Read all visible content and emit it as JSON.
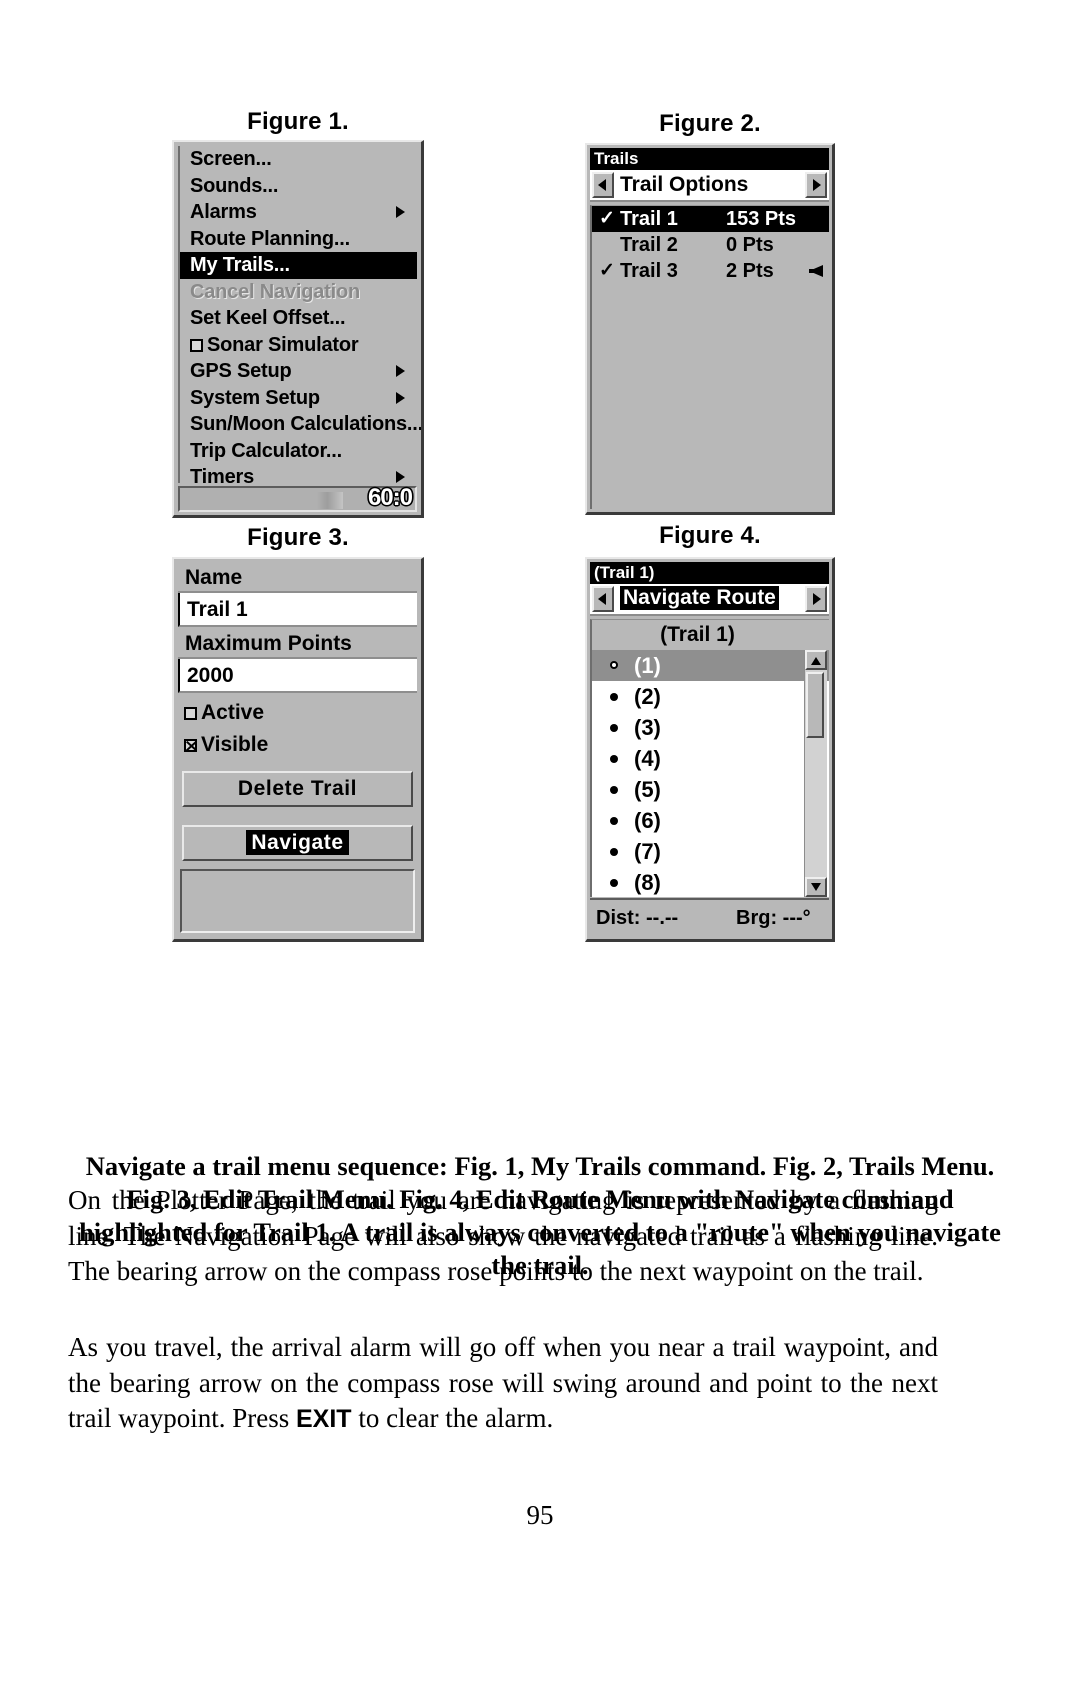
{
  "page": {
    "number": "95"
  },
  "figures": {
    "fig1": {
      "label": "Figure 1.",
      "menu_items": [
        {
          "label": "Screen...",
          "state": "normal",
          "arrow": false,
          "checkbox": null
        },
        {
          "label": "Sounds...",
          "state": "normal",
          "arrow": false,
          "checkbox": null
        },
        {
          "label": "Alarms",
          "state": "normal",
          "arrow": true,
          "checkbox": null
        },
        {
          "label": "Route Planning...",
          "state": "normal",
          "arrow": false,
          "checkbox": null
        },
        {
          "label": "My Trails...",
          "state": "selected",
          "arrow": false,
          "checkbox": null
        },
        {
          "label": "Cancel Navigation",
          "state": "disabled",
          "arrow": false,
          "checkbox": null
        },
        {
          "label": "Set Keel Offset...",
          "state": "normal",
          "arrow": false,
          "checkbox": null
        },
        {
          "label": "Sonar Simulator",
          "state": "normal",
          "arrow": false,
          "checkbox": "unchecked"
        },
        {
          "label": "GPS Setup",
          "state": "normal",
          "arrow": true,
          "checkbox": null
        },
        {
          "label": "System Setup",
          "state": "normal",
          "arrow": true,
          "checkbox": null
        },
        {
          "label": "Sun/Moon Calculations...",
          "state": "normal",
          "arrow": false,
          "checkbox": null
        },
        {
          "label": "Trip Calculator...",
          "state": "normal",
          "arrow": false,
          "checkbox": null
        },
        {
          "label": "Timers",
          "state": "normal",
          "arrow": true,
          "checkbox": null
        }
      ],
      "status_clock": "60:0"
    },
    "fig2": {
      "label": "Figure 2.",
      "title": "Trails",
      "option_label": "Trail Options",
      "rows": [
        {
          "check": "✓",
          "name": "Trail 1",
          "points": "153 Pts",
          "selected": true,
          "cursor": false
        },
        {
          "check": "",
          "name": "Trail 2",
          "points": "0 Pts",
          "selected": false,
          "cursor": false
        },
        {
          "check": "✓",
          "name": "Trail 3",
          "points": "2 Pts",
          "selected": false,
          "cursor": true
        }
      ]
    },
    "fig3": {
      "label": "Figure 3.",
      "name_label": "Name",
      "name_value": "Trail 1",
      "maxpoints_label": "Maximum Points",
      "maxpoints_value": "2000",
      "active_label": "Active",
      "active_checked": false,
      "visible_label": "Visible",
      "visible_checked": true,
      "delete_button": "Delete Trail",
      "navigate_button": "Navigate"
    },
    "fig4": {
      "label": "Figure 4.",
      "title": "(Trail 1)",
      "option_label": "Navigate Route",
      "list_header": "(Trail 1)",
      "waypoints": [
        {
          "label": "(1)",
          "selected": true
        },
        {
          "label": "(2)",
          "selected": false
        },
        {
          "label": "(3)",
          "selected": false
        },
        {
          "label": "(4)",
          "selected": false
        },
        {
          "label": "(5)",
          "selected": false
        },
        {
          "label": "(6)",
          "selected": false
        },
        {
          "label": "(7)",
          "selected": false
        },
        {
          "label": "(8)",
          "selected": false
        }
      ],
      "dist_label": "Dist: --.--",
      "brg_label": "Brg: ---°"
    }
  },
  "caption": "Navigate a trail menu sequence: Fig. 1, My Trails command. Fig. 2, Trails Menu. Fig. 3, Edit Trail Menu. Fig. 4, Edit Route Menu with Navigate command highlighted for Trail 1. A trail is always converted to a \"route\" when you navigate the trail.",
  "body": {
    "para1": "On the Plotter Page, the trail you are navigating is represented by a flashing line. The Navigation Page will also show the navigated trail as a flashing line. The bearing arrow on the compass rose points to the next waypoint on the trail.",
    "para2_before": "As you travel, the arrival alarm will go off when you near a trail waypoint, and the bearing arrow on the compass rose will swing around and point to the next trail waypoint. Press ",
    "para2_key": "EXIT",
    "para2_after": " to clear the alarm."
  }
}
